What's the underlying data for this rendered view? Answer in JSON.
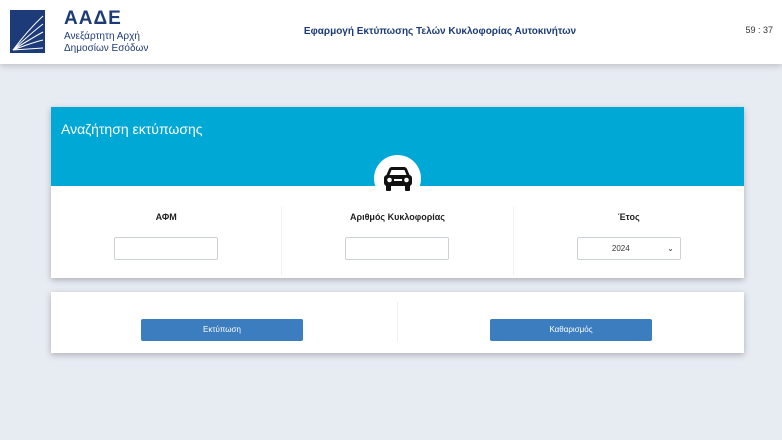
{
  "header": {
    "logo_title": "ΑΑΔΕ",
    "logo_sub_line1": "Ανεξάρτητη Αρχή",
    "logo_sub_line2": "Δημοσίων Εσόδων",
    "app_title": "Εφαρμογή Εκτύπωσης Τελών Κυκλοφορίας Αυτοκινήτων",
    "clock": "59 : 37"
  },
  "search_card": {
    "title": "Αναζήτηση εκτύπωσης",
    "badge_icon": "car-icon",
    "fields": {
      "afm": {
        "label": "ΑΦΜ",
        "value": ""
      },
      "plate": {
        "label": "Αριθμός Κυκλοφορίας",
        "value": ""
      },
      "year": {
        "label": "Έτος",
        "selected": "2024"
      }
    }
  },
  "actions": {
    "print_label": "Εκτύπωση",
    "clear_label": "Καθαρισμός"
  },
  "colors": {
    "brand_navy": "#1d3b78",
    "header_accent": "#00a8d6",
    "button": "#3b7dbf",
    "background": "#e7ebf2"
  }
}
